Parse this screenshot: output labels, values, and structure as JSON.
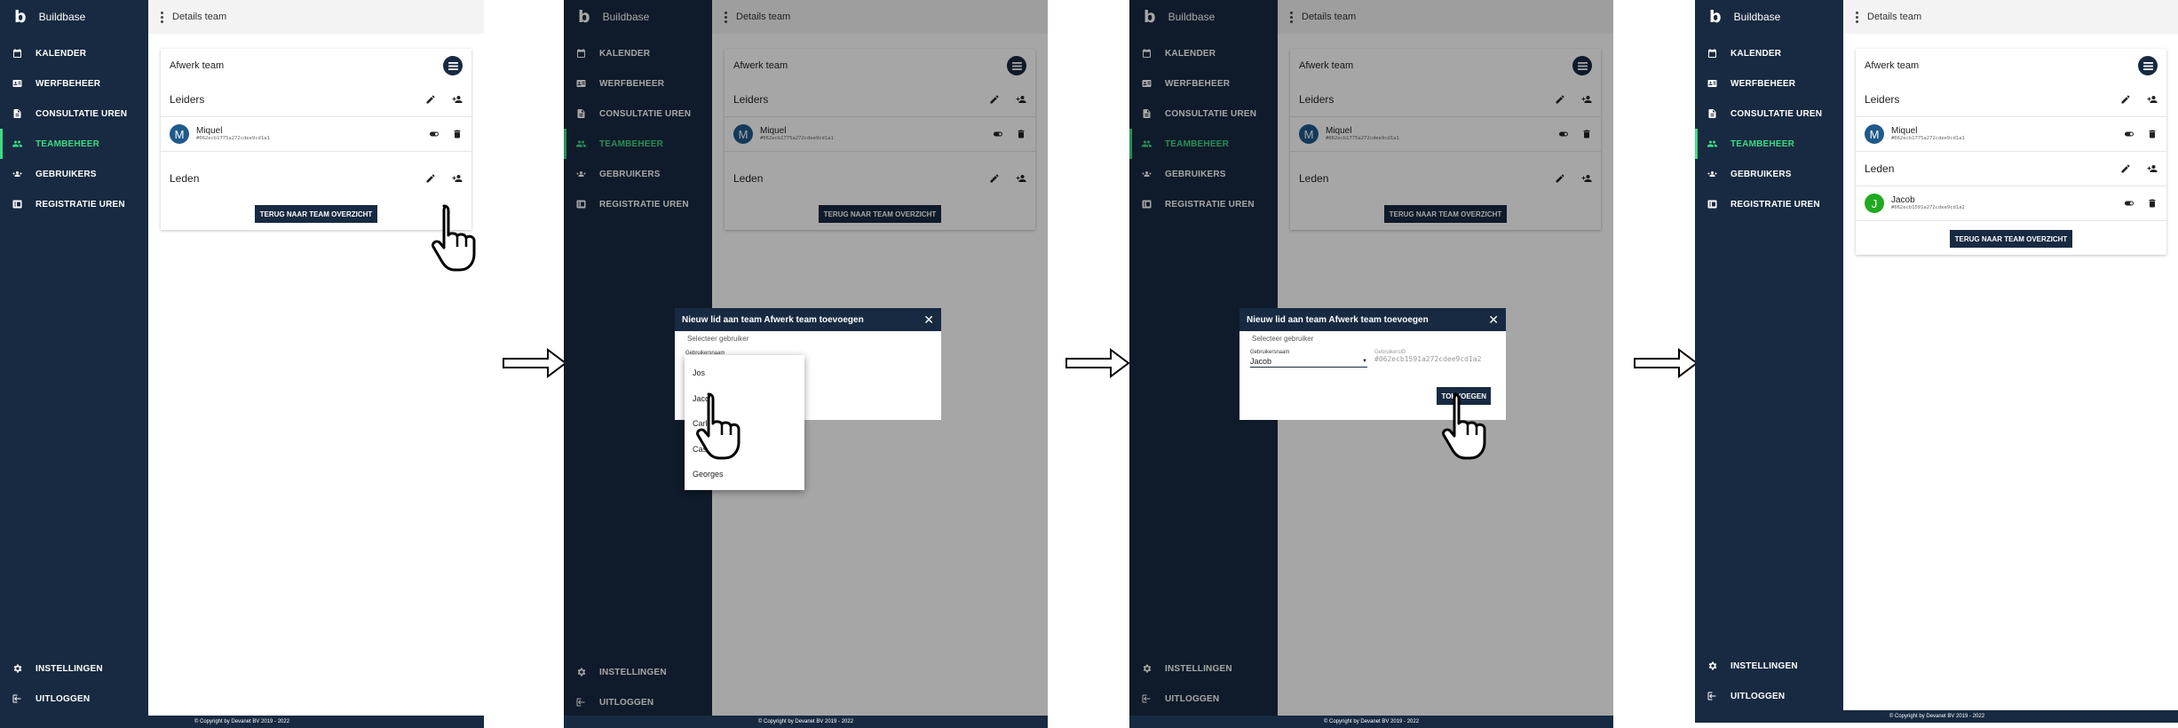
{
  "app": {
    "logo_letter": "b",
    "name": "Buildbase"
  },
  "nav": [
    {
      "label": "KALENDER",
      "icon": "calendar-icon"
    },
    {
      "label": "WERFBEHEER",
      "icon": "id-card-icon"
    },
    {
      "label": "CONSULTATIE UREN",
      "icon": "document-icon"
    },
    {
      "label": "TEAMBEHEER",
      "icon": "team-icon",
      "active": true
    },
    {
      "label": "GEBRUIKERS",
      "icon": "users-icon"
    },
    {
      "label": "REGISTRATIE UREN",
      "icon": "clock-register-icon"
    }
  ],
  "bottom_nav": [
    {
      "label": "INSTELLINGEN",
      "icon": "gear-icon"
    },
    {
      "label": "UITLOGGEN",
      "icon": "logout-icon"
    }
  ],
  "footer": "© Copyright by Devanet BV 2019 - 2022",
  "page_title": "Details team",
  "team_name": "Afwerk team",
  "sections": {
    "leaders": "Leiders",
    "members": "Leden"
  },
  "leader": {
    "initial": "M",
    "name": "Miquel",
    "id": "#062ecb1775a272cdee9cd1a1"
  },
  "new_member": {
    "initial": "J",
    "name": "Jacob",
    "id": "#062ecb1591a272cdee9cd1a2"
  },
  "back_button": "TERUG NAAR TEAM OVERZICHT",
  "dialog": {
    "title": "Nieuw lid aan team Afwerk team toevoegen",
    "close": "✕",
    "subtitle": "Selecteer gebruiker",
    "username_label": "Gebruikersnaam",
    "userid_label": "GebruikersID",
    "selected_user": "Jacob",
    "selected_user_id": "#062ecb1591a272cdee9cd1a2",
    "add_button": "TOEVOEGEN"
  },
  "dropdown_options": [
    "Jos",
    "Jacob",
    "Carl",
    "Cas",
    "Georges"
  ],
  "colors": {
    "sidebar": "#172a41",
    "accent": "#3ddc84",
    "avatar_blue": "#1f5a8c",
    "avatar_green": "#21a921"
  }
}
